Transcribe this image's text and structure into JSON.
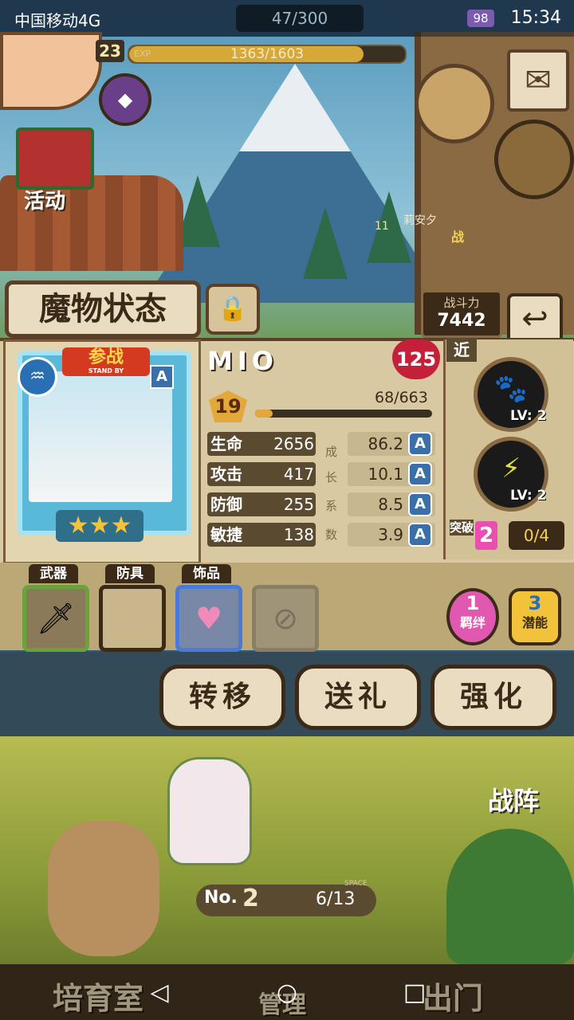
{
  "status_bar": {
    "carrier": "中国移动4G",
    "stamina": "47/300",
    "battery": "98",
    "time": "15:34"
  },
  "top_hud": {
    "level": "23",
    "exp_label": "EXP",
    "exp_text": "1363/1603",
    "exp_fraction": 0.85,
    "event_label": "活动",
    "companion_level": "11",
    "companion_name": "莉安夕",
    "companion_tag": "战"
  },
  "title": {
    "screen_title": "魔物状态",
    "power_label": "战斗力",
    "power_value": "7442"
  },
  "monster": {
    "standby_title": "参战",
    "standby_sub": "STAND BY",
    "rank": "A",
    "element_icon": "water-icon",
    "stars": 3,
    "name": "MIO",
    "hp_badge": "125",
    "level": "19",
    "exp_text": "68/663",
    "exp_fraction": 0.1,
    "stats": [
      {
        "label": "生命",
        "value": "2656",
        "growth": "86.2",
        "grade": "A"
      },
      {
        "label": "攻击",
        "value": "417",
        "growth": "10.1",
        "grade": "A"
      },
      {
        "label": "防御",
        "value": "255",
        "growth": "8.5",
        "grade": "A"
      },
      {
        "label": "敏捷",
        "value": "138",
        "growth": "3.9",
        "grade": "A"
      }
    ],
    "growth_col_chars": [
      "成",
      "长",
      "系",
      "数"
    ]
  },
  "skills": {
    "range_label": "近",
    "items": [
      {
        "icon": "paw-icon",
        "level": "LV: 2"
      },
      {
        "icon": "bolt-icon",
        "level": "LV: 2"
      }
    ],
    "breakthrough_label": "突破",
    "breakthrough_count": "2",
    "breakthrough_progress": "0/4"
  },
  "equipment": {
    "tabs": [
      "武器",
      "防具",
      "饰品"
    ],
    "bond_count": "1",
    "bond_label": "羁绊",
    "potential_count": "3",
    "potential_label": "潜能"
  },
  "actions": {
    "transfer": "转移",
    "gift": "送礼",
    "enhance": "强化"
  },
  "scene": {
    "formation_label": "战阵",
    "no_label": "No.",
    "no_value": "2",
    "space_label": "SPACE",
    "space_value": "6/13"
  },
  "bottom_nav": {
    "nurture": "培育室",
    "manage": "管理",
    "go_out": "出门"
  }
}
